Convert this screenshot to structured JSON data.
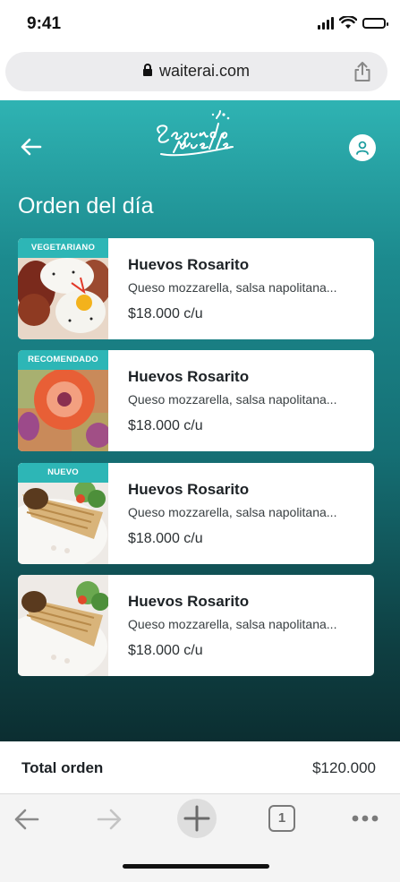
{
  "status": {
    "time": "9:41"
  },
  "browser": {
    "url": "waiterai.com"
  },
  "page": {
    "title": "Orden del día",
    "items": [
      {
        "badge": "VEGETARIANO",
        "name": "Huevos Rosarito",
        "description": "Queso mozzarella, salsa napolitana...",
        "price": "$18.000 c/u"
      },
      {
        "badge": "RECOMENDADO",
        "name": "Huevos Rosarito",
        "description": "Queso mozzarella, salsa napolitana...",
        "price": "$18.000 c/u"
      },
      {
        "badge": "NUEVO",
        "name": "Huevos Rosarito",
        "description": "Queso mozzarella, salsa napolitana...",
        "price": "$18.000 c/u"
      },
      {
        "badge": "",
        "name": "Huevos Rosarito",
        "description": "Queso mozzarella, salsa napolitana...",
        "price": "$18.000 c/u"
      }
    ]
  },
  "total": {
    "label": "Total orden",
    "value": "$120.000"
  },
  "toolbar": {
    "tab_count": "1"
  },
  "colors": {
    "accent": "#2db6b6",
    "header_top": "#2fb3b3",
    "header_bottom": "#0c2e31"
  },
  "icons": [
    "back-arrow-icon",
    "profile-icon",
    "share-icon",
    "lock-icon",
    "forward-icon",
    "plus-icon",
    "tabs-icon",
    "more-icon"
  ]
}
